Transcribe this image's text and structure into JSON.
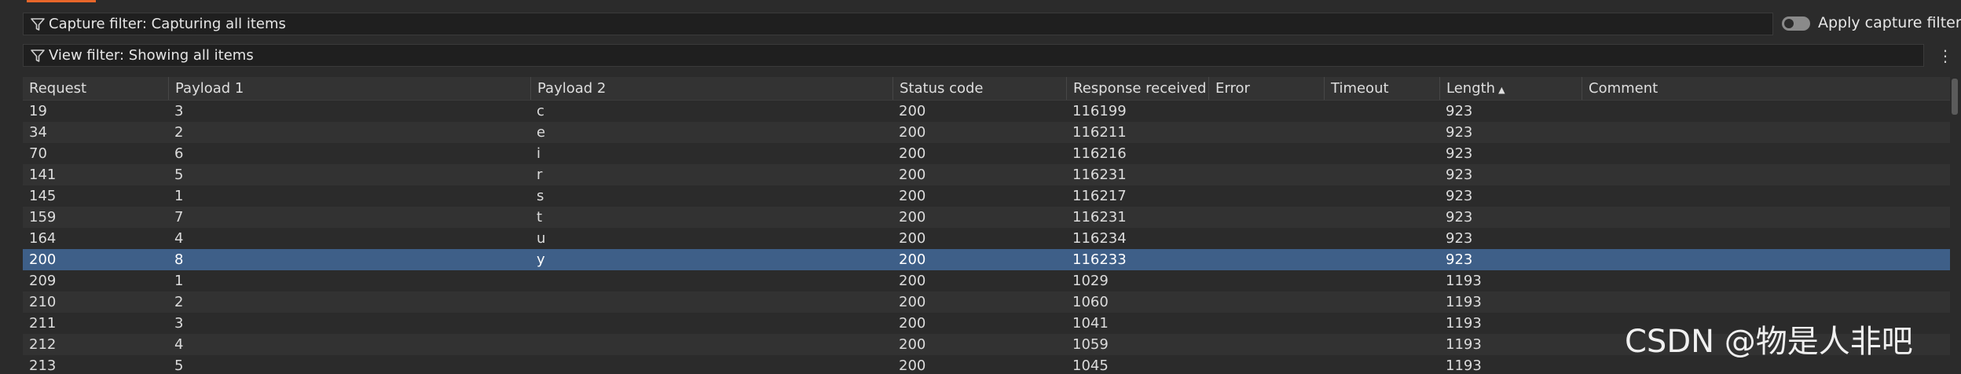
{
  "filters": {
    "capture": "Capture filter: Capturing all items",
    "view": "View filter: Showing all items",
    "apply_capture_label": "Apply capture filter",
    "apply_capture_on": false
  },
  "table": {
    "columns": [
      "Request",
      "Payload 1",
      "Payload 2",
      "Status code",
      "Response received",
      "Error",
      "Timeout",
      "Length",
      "Comment"
    ],
    "sort_column": "Length",
    "sort_direction": "ascending",
    "rows": [
      [
        "19",
        "3",
        "c",
        "200",
        "116199",
        "",
        "",
        "923",
        ""
      ],
      [
        "34",
        "2",
        "e",
        "200",
        "116211",
        "",
        "",
        "923",
        ""
      ],
      [
        "70",
        "6",
        "i",
        "200",
        "116216",
        "",
        "",
        "923",
        ""
      ],
      [
        "141",
        "5",
        "r",
        "200",
        "116231",
        "",
        "",
        "923",
        ""
      ],
      [
        "145",
        "1",
        "s",
        "200",
        "116217",
        "",
        "",
        "923",
        ""
      ],
      [
        "159",
        "7",
        "t",
        "200",
        "116231",
        "",
        "",
        "923",
        ""
      ],
      [
        "164",
        "4",
        "u",
        "200",
        "116234",
        "",
        "",
        "923",
        ""
      ],
      [
        "200",
        "8",
        "y",
        "200",
        "116233",
        "",
        "",
        "923",
        ""
      ],
      [
        "209",
        "1",
        "",
        "200",
        "1029",
        "",
        "",
        "1193",
        ""
      ],
      [
        "210",
        "2",
        "",
        "200",
        "1060",
        "",
        "",
        "1193",
        ""
      ],
      [
        "211",
        "3",
        "",
        "200",
        "1041",
        "",
        "",
        "1193",
        ""
      ],
      [
        "212",
        "4",
        "",
        "200",
        "1059",
        "",
        "",
        "1193",
        ""
      ],
      [
        "213",
        "5",
        "",
        "200",
        "1045",
        "",
        "",
        "1193",
        ""
      ]
    ],
    "selected_request": "200"
  },
  "watermark": "CSDN @物是人非吧",
  "colors": {
    "background": "#2b2b2b",
    "header": "#333333",
    "row_alt": "#323232",
    "selection": "#3e5f88",
    "accent": "#e8662a"
  },
  "icons": {
    "filter": "filter-icon",
    "menu": "more-vertical-icon",
    "sort": "sort-up-icon"
  }
}
